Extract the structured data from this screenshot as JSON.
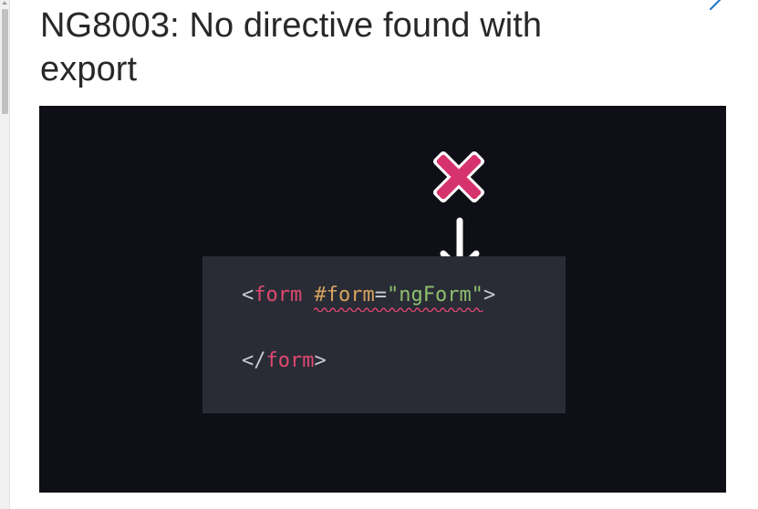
{
  "article": {
    "title": "NG8003: No directive found with export"
  },
  "illustration": {
    "code": {
      "line1": {
        "open_bracket": "<",
        "tag": "form",
        "space": " ",
        "attr": "#form",
        "equals": "=",
        "value": "\"ngForm\"",
        "close_bracket": ">"
      },
      "line2": {
        "open_bracket": "</",
        "tag": "form",
        "close_bracket": ">"
      }
    },
    "error_icon": "x-mark-icon",
    "arrow_icon": "arrow-down-icon",
    "colors": {
      "background": "#0f0f17",
      "panel": "#292c35",
      "tag": "#e0486f",
      "attribute": "#d6a35f",
      "string": "#8fbf6e",
      "error": "#d6336c"
    }
  }
}
